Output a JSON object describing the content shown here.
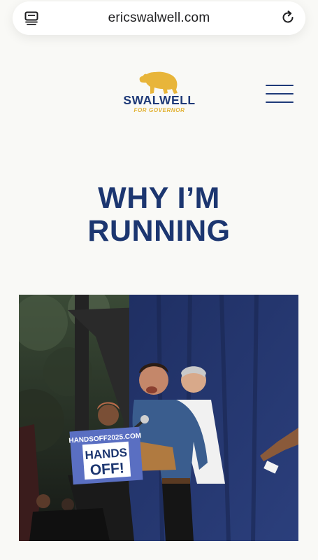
{
  "browser": {
    "url": "ericswalwell.com",
    "tabs_icon": "tabs-icon",
    "reload_icon": "reload-icon"
  },
  "logo": {
    "icon": "bear-icon",
    "name": "SWALWELL",
    "tagline": "FOR GOVERNOR"
  },
  "nav": {
    "menu_icon": "hamburger-menu-icon"
  },
  "page": {
    "title_line1": "WHY I’M",
    "title_line2": "RUNNING"
  },
  "hero": {
    "sign_url": "HANDSOFF2025.COM",
    "sign_line1": "HANDS",
    "sign_line2": "OFF!"
  },
  "colors": {
    "brand_navy": "#1c3670",
    "brand_gold": "#e8b53a",
    "background": "#f9f9f6"
  }
}
